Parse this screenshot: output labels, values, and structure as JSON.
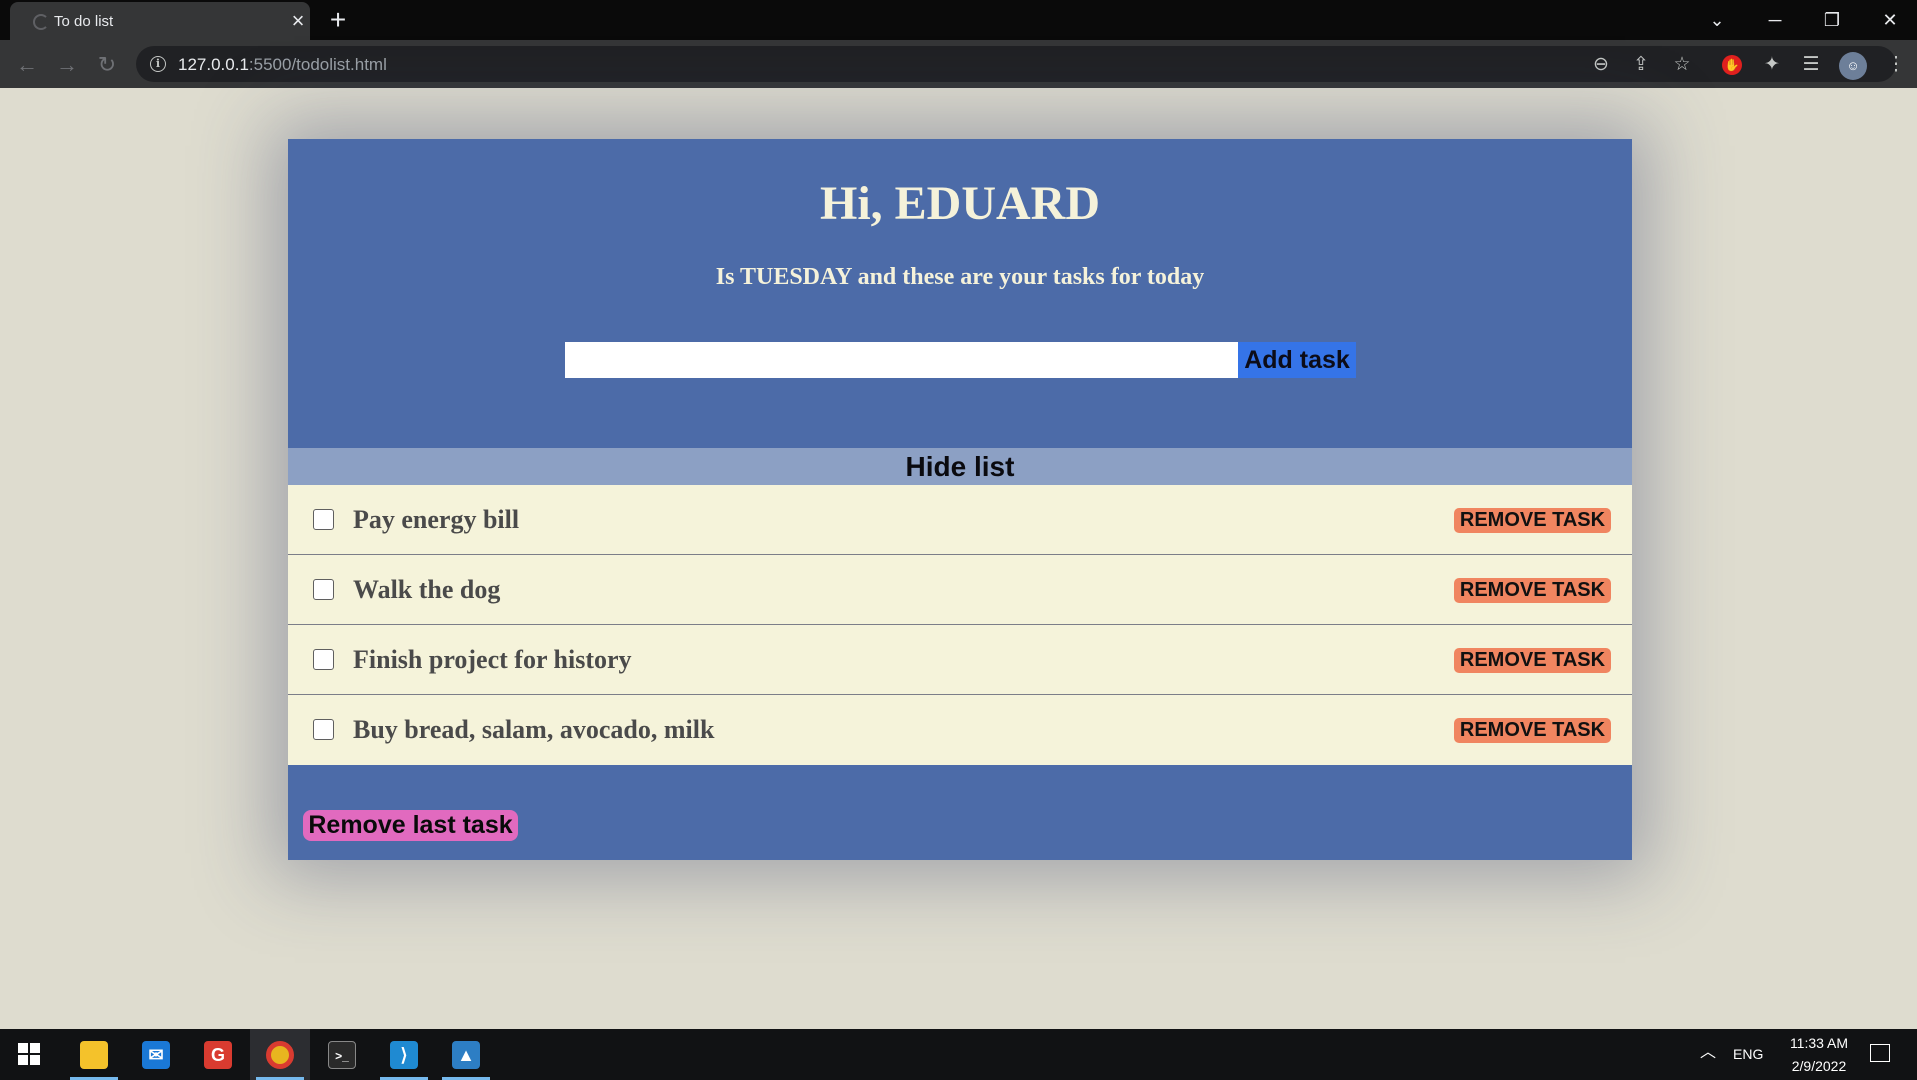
{
  "browser": {
    "tab_title": "To do list",
    "url_host": "127.0.0.1",
    "url_rest": ":5500/todolist.html"
  },
  "page": {
    "greeting": "Hi, EDUARD",
    "subtitle": "Is TUESDAY and these are your tasks for today",
    "input_value": "",
    "add_button": "Add task",
    "hide_list_label": "Hide list",
    "remove_last_label": "Remove last task",
    "tasks": [
      {
        "text": "Pay energy bill",
        "checked": false,
        "remove_label": "REMOVE TASK"
      },
      {
        "text": "Walk the dog",
        "checked": false,
        "remove_label": "REMOVE TASK"
      },
      {
        "text": "Finish project for history",
        "checked": false,
        "remove_label": "REMOVE TASK"
      },
      {
        "text": "Buy bread, salam, avocado, milk",
        "checked": false,
        "remove_label": "REMOVE TASK"
      }
    ]
  },
  "taskbar": {
    "apps": [
      "start-icon",
      "file-explorer-icon",
      "mail-icon",
      "gmail-icon",
      "chrome-icon",
      "terminal-icon",
      "vscode-icon",
      "photos-icon"
    ],
    "language": "ENG",
    "time": "11:33 AM",
    "date": "2/9/2022"
  },
  "colors": {
    "page_bg": "#dedccf",
    "card": "#4c6ba8",
    "hide_bar": "#8ca0c4",
    "task_row": "#f5f3da",
    "add_button": "#3574e8",
    "remove_button": "#f08560",
    "remove_last_button": "#e16abf"
  }
}
